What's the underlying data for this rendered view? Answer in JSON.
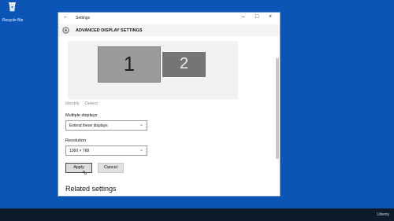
{
  "desktop": {
    "recycle_label": "Recycle Bin"
  },
  "taskbar": {
    "watermark": "Udemy"
  },
  "window": {
    "title": "Settings",
    "page_title": "ADVANCED DISPLAY SETTINGS",
    "monitors": [
      {
        "label": "1"
      },
      {
        "label": "2"
      }
    ],
    "links": {
      "identify": "Identify",
      "detect": "Detect"
    },
    "multiple_displays": {
      "label": "Multiple displays",
      "value": "Extend these displays"
    },
    "resolution": {
      "label": "Resolution",
      "value": "1360 × 768"
    },
    "buttons": {
      "apply": "Apply",
      "cancel": "Cancel"
    },
    "related_heading": "Related settings"
  },
  "icons": [
    "recycle-bin-icon",
    "back-arrow-icon",
    "minimize-icon",
    "maximize-icon",
    "close-icon",
    "gear-icon",
    "chevron-down-icon",
    "mouse-cursor-icon"
  ]
}
